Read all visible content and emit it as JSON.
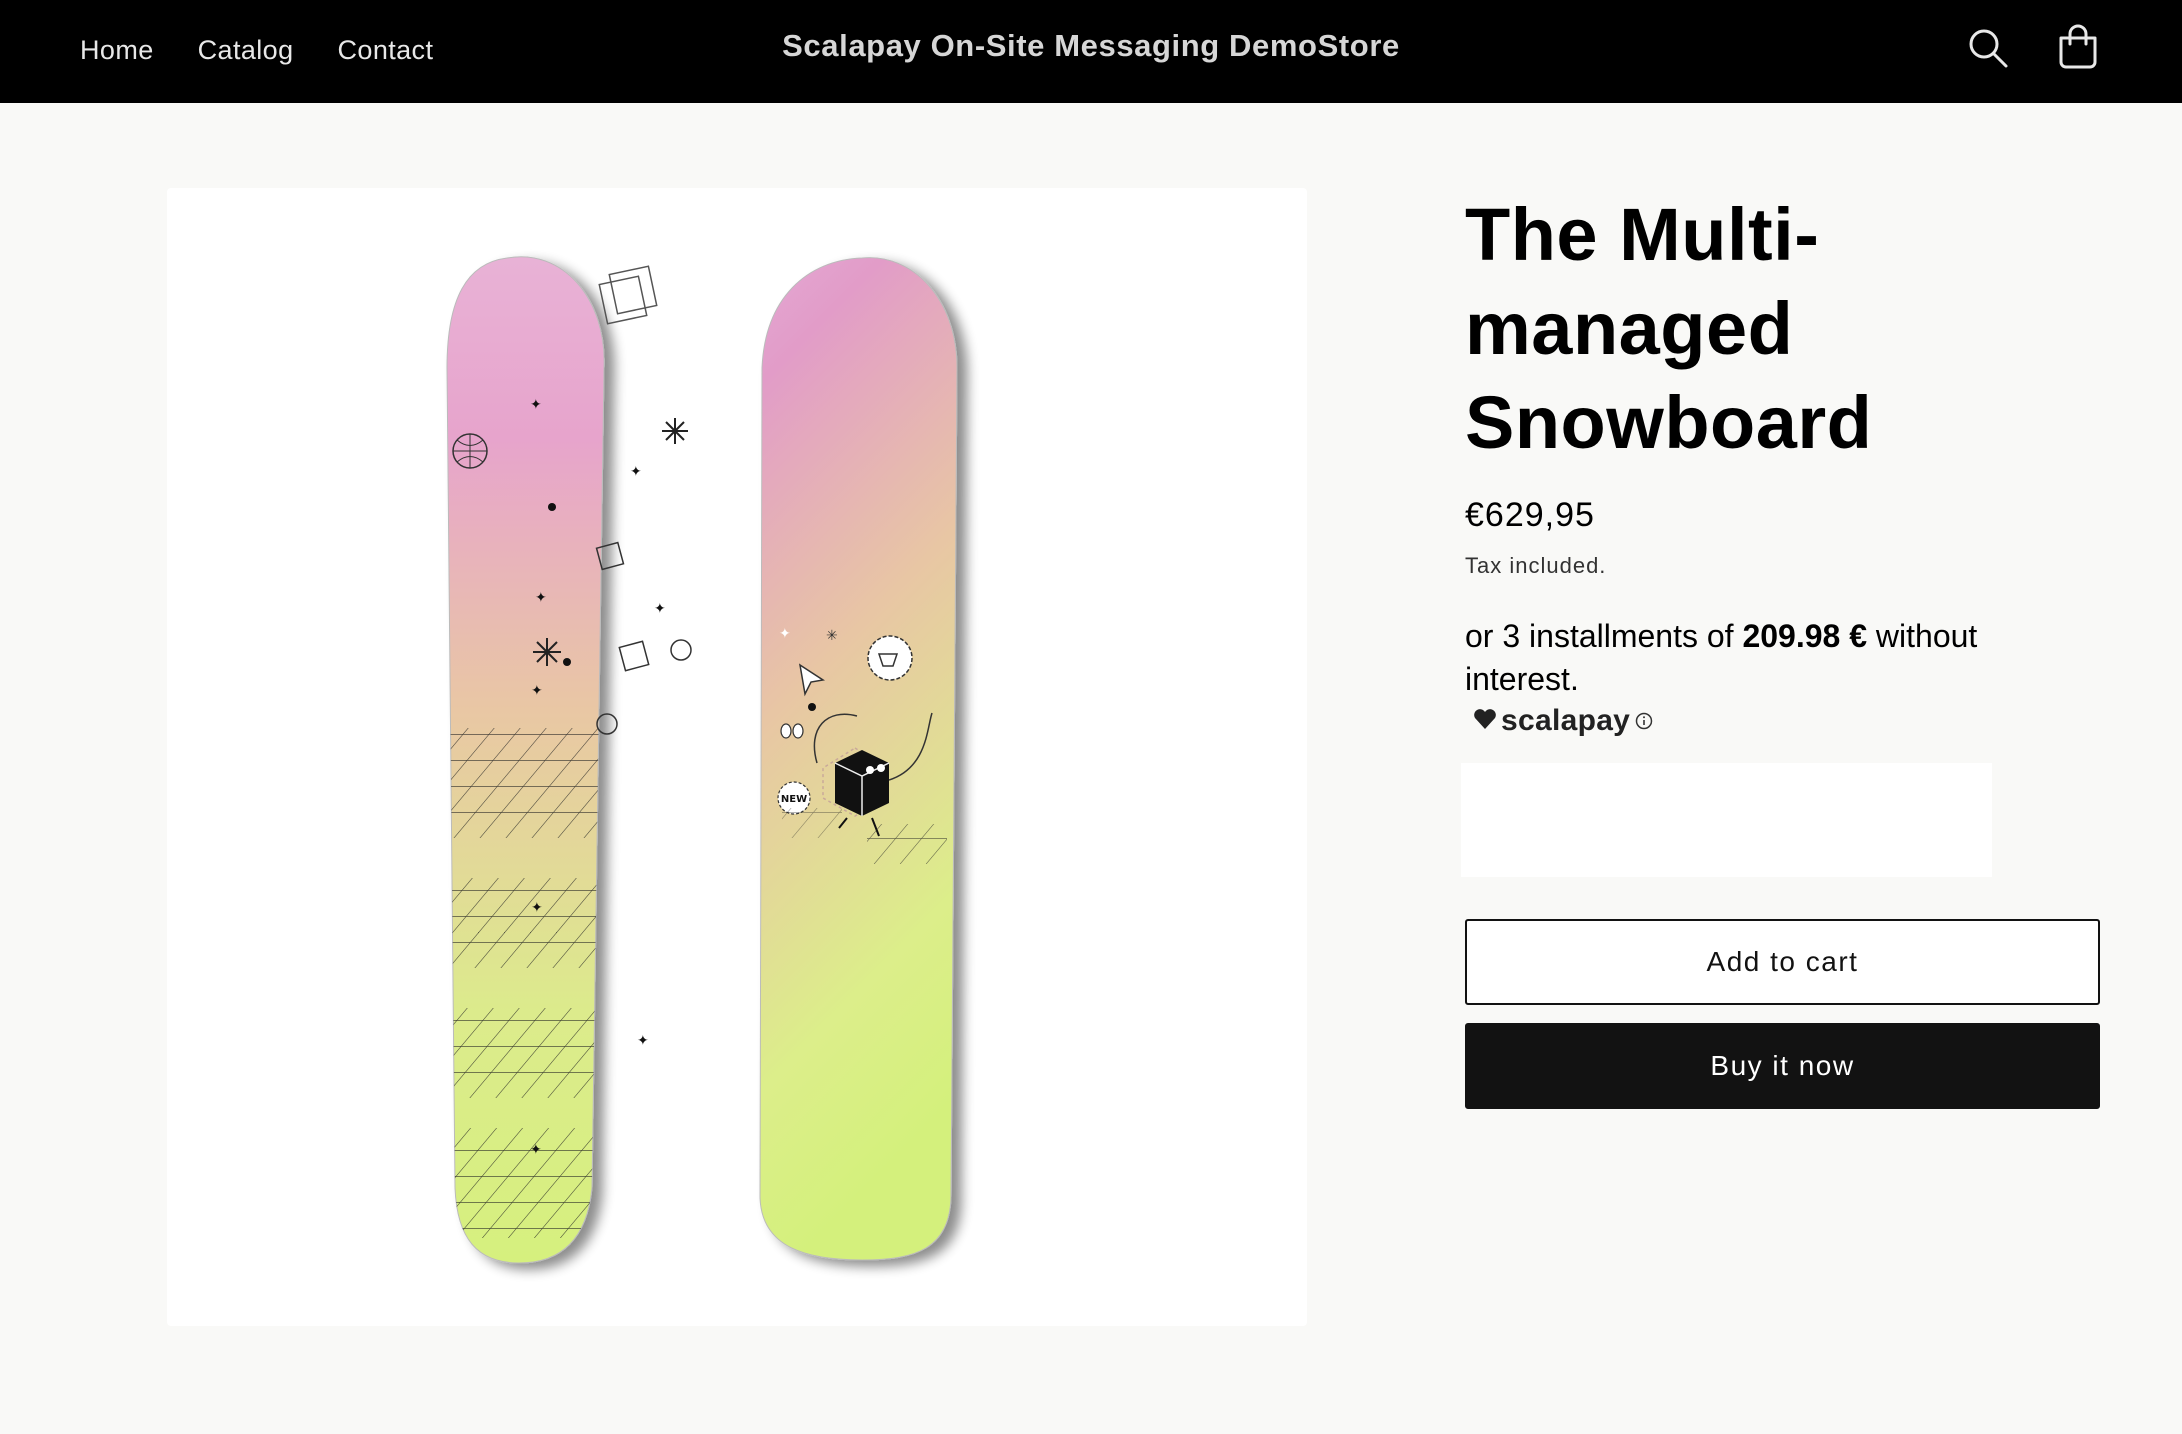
{
  "header": {
    "nav": [
      "Home",
      "Catalog",
      "Contact"
    ],
    "store_title": "Scalapay On-Site Messaging DemoStore",
    "icons": [
      "search-icon",
      "cart-icon"
    ]
  },
  "product": {
    "title": "The Multi-managed Snowboard",
    "price": "€629,95",
    "tax_note": "Tax included.",
    "installments": {
      "prefix": "or 3 installments of ",
      "amount": "209.98 €",
      "suffix": " without interest."
    },
    "brand": "scalapay",
    "badge": "NEW",
    "add_to_cart": "Add to cart",
    "buy_now": "Buy it now"
  },
  "colors": {
    "header_bg": "#000000",
    "page_bg": "#f9f9f7",
    "board_top": "#e6a8cf",
    "board_bottom": "#d8f08a",
    "button_dark": "#121212"
  }
}
